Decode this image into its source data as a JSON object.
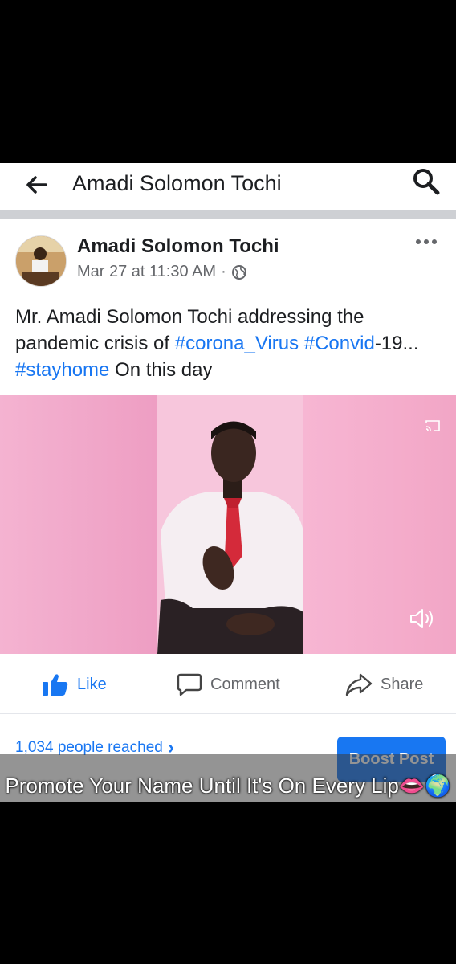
{
  "header": {
    "title": "Amadi Solomon Tochi",
    "back_icon": "back-arrow-icon",
    "search_icon": "search-icon"
  },
  "post": {
    "author": "Amadi Solomon Tochi",
    "timestamp": "Mar 27 at 11:30 AM",
    "separator": "·",
    "privacy_icon": "globe-icon",
    "caption_pre": "Mr. Amadi Solomon Tochi addressing the pandemic crisis of ",
    "tag1": "#corona_Virus",
    "tag2": "#Convid",
    "caption_mid": "-19... ",
    "tag3": "#stayhome",
    "caption_post": " On this day"
  },
  "actions": {
    "like": "Like",
    "comment": "Comment",
    "share": "Share"
  },
  "insights": {
    "reached": "1,034 people reached",
    "chevron": "›",
    "boost": "Boost Post"
  },
  "overlay": {
    "text": "Promote Your Name Until It's On Every Lip👄🌍"
  },
  "colors": {
    "accent": "#1877f2",
    "video_bg": "#f0a7c8"
  }
}
